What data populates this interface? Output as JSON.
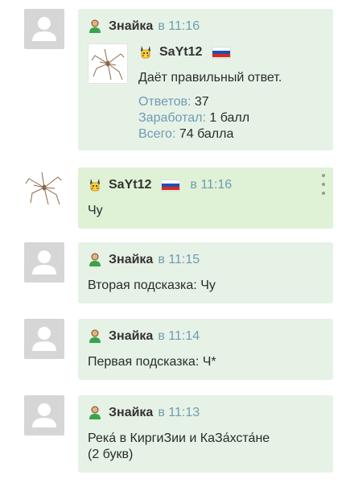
{
  "messages": [
    {
      "author": "Знайка",
      "time_prefix": "в",
      "time": "11:16",
      "card": {
        "name": "SaYt12",
        "text": "Даёт правильный ответ.",
        "stats": [
          {
            "label": "Ответов:",
            "value": "37"
          },
          {
            "label": "Заработал:",
            "value": "1 балл"
          },
          {
            "label": "Всего:",
            "value": "74 балла"
          }
        ]
      }
    },
    {
      "author": "SaYt12",
      "time_prefix": "в",
      "time": "11:16",
      "text": "Чу"
    },
    {
      "author": "Знайка",
      "time_prefix": "в",
      "time": "11:15",
      "text": "Вторая подсказка: Чу"
    },
    {
      "author": "Знайка",
      "time_prefix": "в",
      "time": "11:14",
      "text": "Первая подсказка: Ч*"
    },
    {
      "author": "Знайка",
      "time_prefix": "в",
      "time": "11:13",
      "text_line1": "Река́ в КиргиЗии и КаЗа́хста́не",
      "text_line2": "(2 букв)"
    }
  ],
  "colors": {
    "bubble_bot": "#e6f2e6",
    "bubble_user": "#dff2d6",
    "time": "#6f9bb5"
  },
  "icons": {
    "bot_user": "green-user-icon",
    "player": "pikachu-icon",
    "flag": "russia-flag-icon",
    "avatar_default": "default-avatar-icon",
    "avatar_player": "spider-avatar"
  }
}
